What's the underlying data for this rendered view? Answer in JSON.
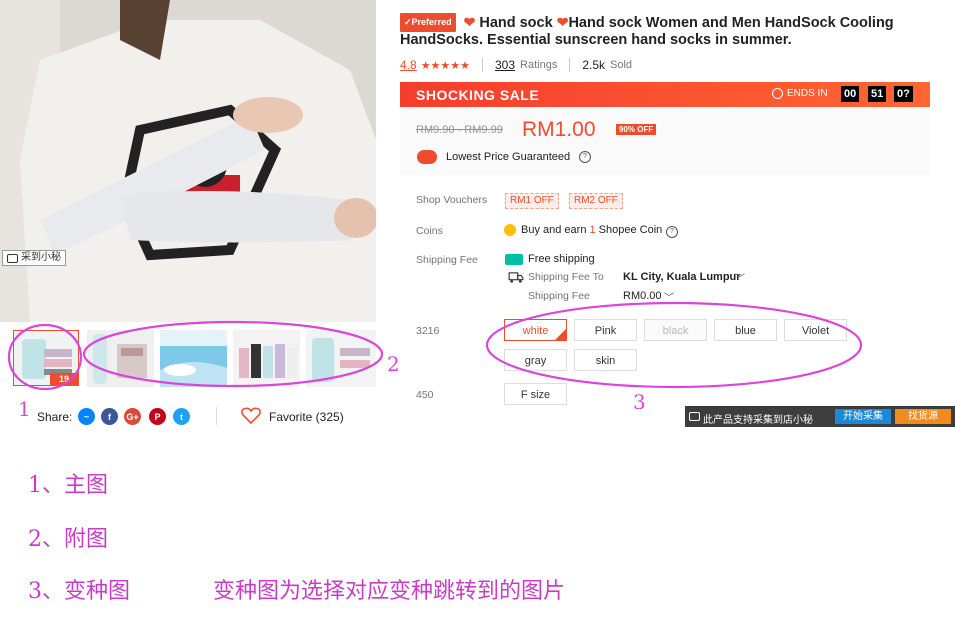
{
  "main_image": {
    "alt": "product photo",
    "capture_tag": "采到小秘"
  },
  "thumbnails": [
    {
      "badge": "19",
      "active": true
    },
    {
      "badge": "",
      "active": false
    },
    {
      "badge": "",
      "active": false
    },
    {
      "badge": "",
      "active": false
    },
    {
      "badge": "",
      "active": false
    }
  ],
  "share": {
    "label": "Share:",
    "icons": [
      "messenger-icon",
      "facebook-icon",
      "google-plus-icon",
      "pinterest-icon",
      "twitter-icon"
    ]
  },
  "favorite": {
    "label": "Favorite (325)"
  },
  "product": {
    "preferred_badge": "Preferred",
    "title_part1": "Hand sock",
    "title_part2": "Hand sock Women and Men HandSock Cooling HandSocks. Essential sunscreen hand socks in summer.",
    "rating": "4.8",
    "ratings_count": "303",
    "ratings_label": "Ratings",
    "sold_count": "2.5k",
    "sold_label": "Sold"
  },
  "sale": {
    "title": "SHOCKING SALE",
    "ends_label": "ENDS IN",
    "hours": "00",
    "minutes": "51",
    "seconds": "0?"
  },
  "price": {
    "original_range": "RM9.90 - RM9.99",
    "current": "RM1.00",
    "discount": "90% OFF",
    "guarantee": "Lowest Price Guaranteed"
  },
  "vouchers": {
    "label": "Shop Vouchers",
    "items": [
      "RM1 OFF",
      "RM2 OFF"
    ]
  },
  "coins": {
    "label": "Coins",
    "text_before": "Buy and earn ",
    "amount": "1",
    "text_after": " Shopee Coin"
  },
  "shipping": {
    "label": "Shipping Fee",
    "free": "Free shipping",
    "to_label": "Shipping Fee To",
    "to_value": "KL City, Kuala Lumpur",
    "fee_label": "Shipping Fee",
    "fee_value": "RM0.00"
  },
  "variation1": {
    "label": "3216",
    "options": [
      "white",
      "Pink",
      "black",
      "blue",
      "Violet",
      "gray",
      "skin"
    ]
  },
  "variation2": {
    "label": "450",
    "options": [
      "F size"
    ]
  },
  "plugin": {
    "text": "此产品支持采集到店小秘",
    "btn1": "开始采集",
    "btn2": "找货源"
  },
  "annotations": {
    "n1": "1",
    "n2": "2",
    "n3": "3",
    "note1": "1、主图",
    "note2": "2、附图",
    "note3a": "3、变种图",
    "note3b": "变种图为选择对应变种跳转到的图片"
  },
  "colors": {
    "accent": "#ee4d2d",
    "annotation": "#d946d9"
  }
}
